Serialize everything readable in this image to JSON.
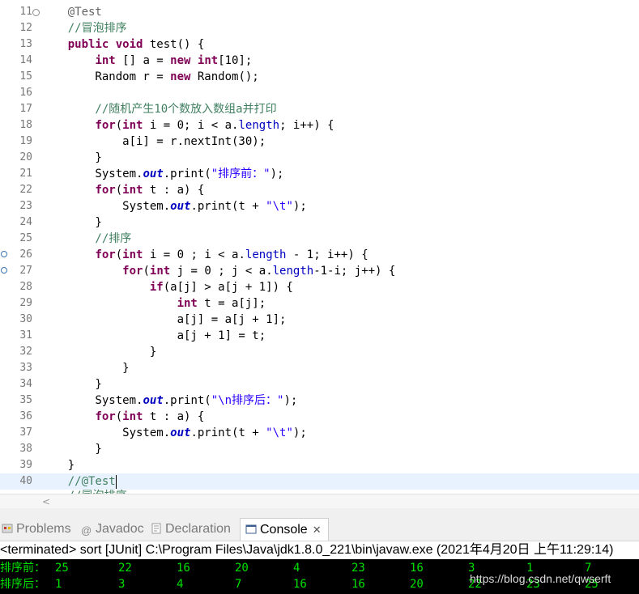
{
  "editor": {
    "lines": [
      {
        "n": "11",
        "fold": true,
        "toks": [
          [
            "an",
            "    @Test"
          ]
        ]
      },
      {
        "n": "12",
        "toks": [
          [
            "cm",
            "    //冒泡排序"
          ]
        ]
      },
      {
        "n": "13",
        "toks": [
          [
            "",
            "    "
          ],
          [
            "kw",
            "public"
          ],
          [
            "",
            " "
          ],
          [
            "kw",
            "void"
          ],
          [
            "",
            " test() {"
          ]
        ]
      },
      {
        "n": "14",
        "toks": [
          [
            "",
            "        "
          ],
          [
            "kw",
            "int"
          ],
          [
            "",
            " [] a = "
          ],
          [
            "kw",
            "new"
          ],
          [
            "",
            " "
          ],
          [
            "kw",
            "int"
          ],
          [
            "",
            "[10];"
          ]
        ]
      },
      {
        "n": "15",
        "toks": [
          [
            "",
            "        Random r = "
          ],
          [
            "kw",
            "new"
          ],
          [
            "",
            " Random();"
          ]
        ]
      },
      {
        "n": "16",
        "toks": []
      },
      {
        "n": "17",
        "toks": [
          [
            "cm",
            "        //随机产生10个数放入数组a并打印"
          ]
        ]
      },
      {
        "n": "18",
        "toks": [
          [
            "",
            "        "
          ],
          [
            "kw",
            "for"
          ],
          [
            "",
            "("
          ],
          [
            "kw",
            "int"
          ],
          [
            "",
            " i = 0; i < a."
          ],
          [
            "fd",
            "length"
          ],
          [
            "",
            "; i++) {"
          ]
        ]
      },
      {
        "n": "19",
        "toks": [
          [
            "",
            "            a[i] = r.nextInt(30);"
          ]
        ]
      },
      {
        "n": "20",
        "toks": [
          [
            "",
            "        }"
          ]
        ]
      },
      {
        "n": "21",
        "toks": [
          [
            "",
            "        System."
          ],
          [
            "sf",
            "out"
          ],
          [
            "",
            ".print("
          ],
          [
            "st",
            "\"排序前：\""
          ],
          [
            "",
            ");"
          ]
        ]
      },
      {
        "n": "22",
        "toks": [
          [
            "",
            "        "
          ],
          [
            "kw",
            "for"
          ],
          [
            "",
            "("
          ],
          [
            "kw",
            "int"
          ],
          [
            "",
            " t : a) {"
          ]
        ]
      },
      {
        "n": "23",
        "toks": [
          [
            "",
            "            System."
          ],
          [
            "sf",
            "out"
          ],
          [
            "",
            ".print(t + "
          ],
          [
            "st",
            "\"\\t\""
          ],
          [
            "",
            ");"
          ]
        ]
      },
      {
        "n": "24",
        "toks": [
          [
            "",
            "        }"
          ]
        ]
      },
      {
        "n": "25",
        "toks": [
          [
            "cm",
            "        //排序"
          ]
        ]
      },
      {
        "n": "26",
        "bp": true,
        "toks": [
          [
            "",
            "        "
          ],
          [
            "kw",
            "for"
          ],
          [
            "",
            "("
          ],
          [
            "kw",
            "int"
          ],
          [
            "",
            " i = 0 ; i < a."
          ],
          [
            "fd",
            "length"
          ],
          [
            "",
            " - 1; i++) {"
          ]
        ]
      },
      {
        "n": "27",
        "bp": true,
        "toks": [
          [
            "",
            "            "
          ],
          [
            "kw",
            "for"
          ],
          [
            "",
            "("
          ],
          [
            "kw",
            "int"
          ],
          [
            "",
            " j = 0 ; j < a."
          ],
          [
            "fd",
            "length"
          ],
          [
            "",
            "-1-i; j++) {"
          ]
        ]
      },
      {
        "n": "28",
        "toks": [
          [
            "",
            "                "
          ],
          [
            "kw",
            "if"
          ],
          [
            "",
            "(a[j] > a[j + 1]) {"
          ]
        ]
      },
      {
        "n": "29",
        "toks": [
          [
            "",
            "                    "
          ],
          [
            "kw",
            "int"
          ],
          [
            "",
            " t = a[j];"
          ]
        ]
      },
      {
        "n": "30",
        "toks": [
          [
            "",
            "                    a[j] = a[j + 1];"
          ]
        ]
      },
      {
        "n": "31",
        "toks": [
          [
            "",
            "                    a[j + 1] = t;"
          ]
        ]
      },
      {
        "n": "32",
        "toks": [
          [
            "",
            "                }"
          ]
        ]
      },
      {
        "n": "33",
        "toks": [
          [
            "",
            "            }"
          ]
        ]
      },
      {
        "n": "34",
        "toks": [
          [
            "",
            "        }"
          ]
        ]
      },
      {
        "n": "35",
        "toks": [
          [
            "",
            "        System."
          ],
          [
            "sf",
            "out"
          ],
          [
            "",
            ".print("
          ],
          [
            "st",
            "\"\\n排序后：\""
          ],
          [
            "",
            ");"
          ]
        ]
      },
      {
        "n": "36",
        "toks": [
          [
            "",
            "        "
          ],
          [
            "kw",
            "for"
          ],
          [
            "",
            "("
          ],
          [
            "kw",
            "int"
          ],
          [
            "",
            " t : a) {"
          ]
        ]
      },
      {
        "n": "37",
        "toks": [
          [
            "",
            "            System."
          ],
          [
            "sf",
            "out"
          ],
          [
            "",
            ".print(t + "
          ],
          [
            "st",
            "\"\\t\""
          ],
          [
            "",
            ");"
          ]
        ]
      },
      {
        "n": "38",
        "toks": [
          [
            "",
            "        }"
          ]
        ]
      },
      {
        "n": "39",
        "toks": [
          [
            "",
            "    }"
          ]
        ]
      },
      {
        "n": "40",
        "current": true,
        "caret": true,
        "toks": [
          [
            "cm",
            "    //@Test"
          ]
        ]
      }
    ],
    "partial_line": "    //冒泡排序"
  },
  "scrollbar": {
    "left_arrow": "<"
  },
  "tabs": [
    {
      "id": "problems",
      "label": "Problems",
      "icon": "problems-icon",
      "active": false
    },
    {
      "id": "javadoc",
      "label": "Javadoc",
      "icon": "at-icon",
      "active": false
    },
    {
      "id": "declaration",
      "label": "Declaration",
      "icon": "declaration-icon",
      "active": false
    },
    {
      "id": "console",
      "label": "Console",
      "icon": "console-icon",
      "active": true
    }
  ],
  "close_glyph": "✕",
  "console": {
    "status": "<terminated> sort [JUnit] C:\\Program Files\\Java\\jdk1.8.0_221\\bin\\javaw.exe (2021年4月20日 上午11:29:14)",
    "before_label": "排序前：",
    "before_values": [
      "25",
      "22",
      "16",
      "20",
      "4",
      "23",
      "16",
      "3",
      "1",
      "7"
    ],
    "after_label": "排序后：",
    "after_values": [
      "1",
      "3",
      "4",
      "7",
      "16",
      "16",
      "20",
      "22",
      "23",
      "25"
    ]
  },
  "watermark": "https://blog.csdn.net/qwserft",
  "colors": {
    "keyword": "#7f0055",
    "comment": "#3f7f5f",
    "string": "#2a00ff",
    "field": "#0000c0",
    "console_text": "#00e000"
  }
}
